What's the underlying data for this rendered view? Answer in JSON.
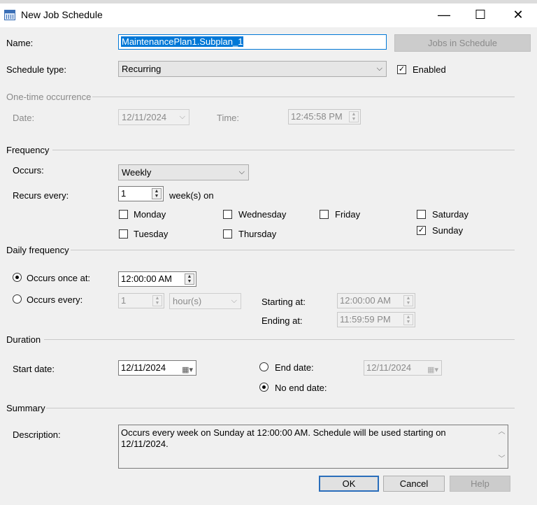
{
  "window": {
    "title": "New Job Schedule",
    "minimize": "—",
    "maximize": "☐",
    "close": "✕"
  },
  "name": {
    "label": "Name:",
    "value": "MaintenancePlan1.Subplan_1",
    "jobs_button": "Jobs in Schedule"
  },
  "schedule_type": {
    "label": "Schedule type:",
    "value": "Recurring",
    "enabled_label": "Enabled",
    "enabled_checked": true
  },
  "one_time": {
    "header": "One-time occurrence",
    "date_label": "Date:",
    "date_value": "12/11/2024",
    "time_label": "Time:",
    "time_value": "12:45:58 PM"
  },
  "frequency": {
    "header": "Frequency",
    "occurs_label": "Occurs:",
    "occurs_value": "Weekly",
    "recurs_label": "Recurs every:",
    "recurs_value": "1",
    "recurs_suffix": "week(s) on",
    "days": {
      "monday": "Monday",
      "tuesday": "Tuesday",
      "wednesday": "Wednesday",
      "thursday": "Thursday",
      "friday": "Friday",
      "saturday": "Saturday",
      "sunday": "Sunday"
    },
    "sunday_checked": true
  },
  "daily": {
    "header": "Daily frequency",
    "once_label": "Occurs once at:",
    "once_value": "12:00:00 AM",
    "every_label": "Occurs every:",
    "every_value": "1",
    "every_unit": "hour(s)",
    "starting_label": "Starting at:",
    "starting_value": "12:00:00 AM",
    "ending_label": "Ending at:",
    "ending_value": "11:59:59 PM",
    "selected": "once"
  },
  "duration": {
    "header": "Duration",
    "start_label": "Start date:",
    "start_value": "12/11/2024",
    "end_label": "End date:",
    "end_value": "12/11/2024",
    "no_end_label": "No end date:",
    "selected": "no_end"
  },
  "summary": {
    "header": "Summary",
    "description_label": "Description:",
    "description": "Occurs every week on Sunday at 12:00:00 AM. Schedule will be used starting on 12/11/2024."
  },
  "buttons": {
    "ok": "OK",
    "cancel": "Cancel",
    "help": "Help"
  },
  "glyphs": {
    "dropdown": "⌵",
    "spin_up": "▲",
    "spin_down": "▼",
    "calendar": "▦▾",
    "check": "✓",
    "scroll_up": "︿",
    "scroll_down": "﹀"
  }
}
